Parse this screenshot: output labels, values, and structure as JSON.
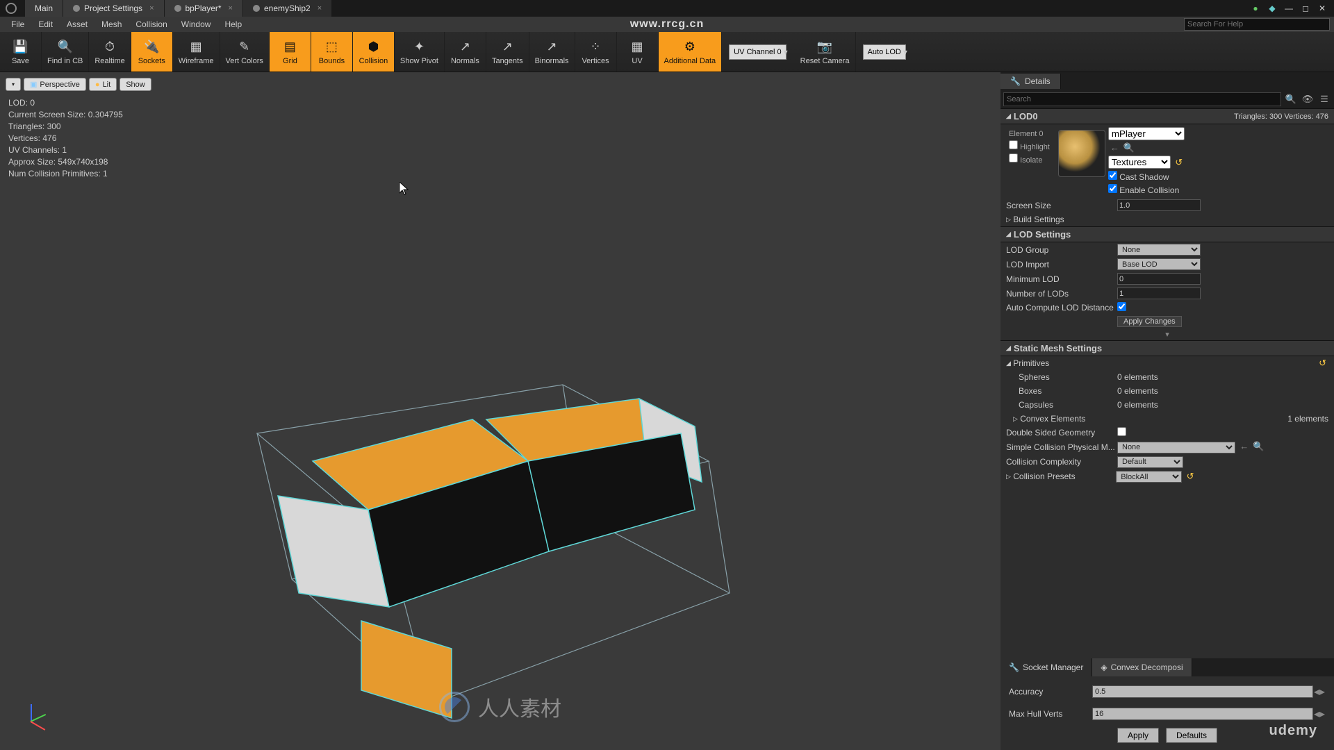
{
  "tabs": [
    "Main",
    "Project Settings",
    "bpPlayer*",
    "enemyShip2"
  ],
  "activeTab": 3,
  "menu": [
    "File",
    "Edit",
    "Asset",
    "Mesh",
    "Collision",
    "Window",
    "Help"
  ],
  "urlWatermark": "www.rrcg.cn",
  "helpSearch": "Search For Help",
  "toolbar": [
    {
      "label": "Save",
      "icon": "💾"
    },
    {
      "label": "Find in CB",
      "icon": "🔍"
    },
    {
      "label": "Realtime",
      "icon": "⏱"
    },
    {
      "label": "Sockets",
      "icon": "🔌",
      "active": true
    },
    {
      "label": "Wireframe",
      "icon": "▦"
    },
    {
      "label": "Vert Colors",
      "icon": "✎"
    },
    {
      "label": "Grid",
      "icon": "▤",
      "active": true
    },
    {
      "label": "Bounds",
      "icon": "⬚",
      "active": true
    },
    {
      "label": "Collision",
      "icon": "⬢",
      "active": true
    },
    {
      "label": "Show Pivot",
      "icon": "✦"
    },
    {
      "label": "Normals",
      "icon": "↗"
    },
    {
      "label": "Tangents",
      "icon": "↗"
    },
    {
      "label": "Binormals",
      "icon": "↗"
    },
    {
      "label": "Vertices",
      "icon": "⁘"
    },
    {
      "label": "UV",
      "icon": "▦"
    },
    {
      "label": "Additional Data",
      "icon": "⚙",
      "active": true
    }
  ],
  "uvChannel": "UV Channel 0",
  "resetCamera": "Reset Camera",
  "autoLod": "Auto LOD",
  "vpButtons": {
    "menu": "▾",
    "perspective": "Perspective",
    "lit": "Lit",
    "show": "Show"
  },
  "stats": {
    "lod": "LOD:  0",
    "screenSize": "Current Screen Size:  0.304795",
    "triangles": "Triangles:  300",
    "vertices": "Vertices:  476",
    "uvChannels": "UV Channels:  1",
    "approxSize": "Approx Size: 549x740x198",
    "numCollision": "Num Collision Primitives:  1"
  },
  "details": {
    "title": "Details",
    "search": "Search",
    "lod0": {
      "title": "LOD0",
      "info": "Triangles: 300  Vertices: 476",
      "element": "Element 0",
      "highlight": "Highlight",
      "isolate": "Isolate",
      "material": "mPlayer",
      "textures": "Textures",
      "castShadow": "Cast Shadow",
      "enableCollision": "Enable Collision",
      "screenSize": "Screen Size",
      "screenSizeVal": "1.0",
      "buildSettings": "Build Settings"
    },
    "lodSettings": {
      "title": "LOD Settings",
      "lodGroup": "LOD Group",
      "lodGroupVal": "None",
      "lodImport": "LOD Import",
      "lodImportVal": "Base LOD",
      "minLod": "Minimum LOD",
      "minLodVal": "0",
      "numLods": "Number of LODs",
      "numLodsVal": "1",
      "autoCompute": "Auto Compute LOD Distance",
      "applyChanges": "Apply Changes"
    },
    "staticMesh": {
      "title": "Static Mesh Settings",
      "primitives": "Primitives",
      "spheres": "Spheres",
      "spheresVal": "0 elements",
      "boxes": "Boxes",
      "boxesVal": "0 elements",
      "capsules": "Capsules",
      "capsulesVal": "0 elements",
      "convex": "Convex Elements",
      "convexVal": "1 elements",
      "doubleSided": "Double Sided Geometry",
      "simpleColl": "Simple Collision Physical M...",
      "simpleCollVal": "None",
      "collComplexity": "Collision Complexity",
      "collComplexityVal": "Default",
      "collPresets": "Collision Presets",
      "collPresetsVal": "BlockAll"
    }
  },
  "bottomTabs": {
    "socket": "Socket Manager",
    "convex": "Convex Decomposi"
  },
  "convex": {
    "accuracy": "Accuracy",
    "accuracyVal": "0.5",
    "maxHull": "Max Hull Verts",
    "maxHullVal": "16",
    "apply": "Apply",
    "defaults": "Defaults"
  },
  "udemy": "udemy",
  "centerWm": "人人素材"
}
